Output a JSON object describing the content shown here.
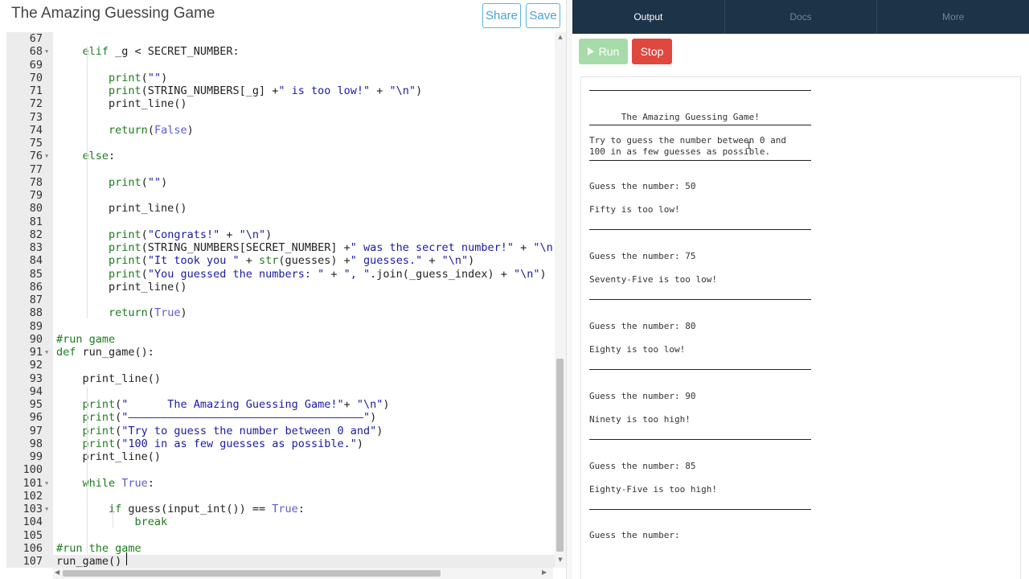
{
  "app": {
    "title": "The Amazing Guessing Game"
  },
  "toolbar": {
    "share_label": "Share",
    "save_label": "Save"
  },
  "tabs": [
    {
      "label": "Output",
      "active": true
    },
    {
      "label": "Docs",
      "active": false
    },
    {
      "label": "More",
      "active": false
    }
  ],
  "controls": {
    "run_label": "Run",
    "stop_label": "Stop"
  },
  "colors": {
    "run": "#a7dcaa",
    "stop": "#e0473f",
    "tabbar": "#1d3347",
    "accent": "#4aa3d3"
  },
  "editor": {
    "active_line": "107",
    "lines": [
      {
        "n": "67",
        "fold": false,
        "t": []
      },
      {
        "n": "68",
        "fold": true,
        "t": [
          [
            "    ",
            ""
          ],
          [
            "elif",
            "kw"
          ],
          [
            " _g < SECRET_NUMBER:",
            ""
          ]
        ]
      },
      {
        "n": "69",
        "fold": false,
        "t": []
      },
      {
        "n": "70",
        "fold": false,
        "t": [
          [
            "        ",
            ""
          ],
          [
            "print",
            "kw"
          ],
          [
            "(",
            ""
          ],
          [
            "\"\"",
            "str"
          ],
          [
            ")",
            ""
          ]
        ]
      },
      {
        "n": "71",
        "fold": false,
        "t": [
          [
            "        ",
            ""
          ],
          [
            "print",
            "kw"
          ],
          [
            "(STRING_NUMBERS[_g] +",
            ""
          ],
          [
            "\" is too low!\"",
            "str"
          ],
          [
            " + ",
            ""
          ],
          [
            "\"\\n\"",
            "str"
          ],
          [
            ")",
            ""
          ]
        ]
      },
      {
        "n": "72",
        "fold": false,
        "t": [
          [
            "        print_line()",
            ""
          ]
        ]
      },
      {
        "n": "73",
        "fold": false,
        "t": []
      },
      {
        "n": "74",
        "fold": false,
        "t": [
          [
            "        ",
            ""
          ],
          [
            "return",
            "kw"
          ],
          [
            "(",
            ""
          ],
          [
            "False",
            "con"
          ],
          [
            ")",
            ""
          ]
        ]
      },
      {
        "n": "75",
        "fold": false,
        "t": []
      },
      {
        "n": "76",
        "fold": true,
        "t": [
          [
            "    ",
            ""
          ],
          [
            "else",
            "kw"
          ],
          [
            ":",
            ""
          ]
        ]
      },
      {
        "n": "77",
        "fold": false,
        "t": []
      },
      {
        "n": "78",
        "fold": false,
        "t": [
          [
            "        ",
            ""
          ],
          [
            "print",
            "kw"
          ],
          [
            "(",
            ""
          ],
          [
            "\"\"",
            "str"
          ],
          [
            ")",
            ""
          ]
        ]
      },
      {
        "n": "79",
        "fold": false,
        "t": []
      },
      {
        "n": "80",
        "fold": false,
        "t": [
          [
            "        print_line()",
            ""
          ]
        ]
      },
      {
        "n": "81",
        "fold": false,
        "t": []
      },
      {
        "n": "82",
        "fold": false,
        "t": [
          [
            "        ",
            ""
          ],
          [
            "print",
            "kw"
          ],
          [
            "(",
            ""
          ],
          [
            "\"Congrats!\"",
            "str"
          ],
          [
            " + ",
            ""
          ],
          [
            "\"\\n\"",
            "str"
          ],
          [
            ")",
            ""
          ]
        ]
      },
      {
        "n": "83",
        "fold": false,
        "t": [
          [
            "        ",
            ""
          ],
          [
            "print",
            "kw"
          ],
          [
            "(STRING_NUMBERS[SECRET_NUMBER] +",
            ""
          ],
          [
            "\" was the secret number!\"",
            "str"
          ],
          [
            " + ",
            ""
          ],
          [
            "\"\\n\"",
            "str"
          ],
          [
            ")",
            ""
          ]
        ]
      },
      {
        "n": "84",
        "fold": false,
        "t": [
          [
            "        ",
            ""
          ],
          [
            "print",
            "kw"
          ],
          [
            "(",
            ""
          ],
          [
            "\"It took you \"",
            "str"
          ],
          [
            " + ",
            ""
          ],
          [
            "str",
            "kw"
          ],
          [
            "(guesses) +",
            ""
          ],
          [
            "\" guesses.\"",
            "str"
          ],
          [
            " + ",
            ""
          ],
          [
            "\"\\n\"",
            "str"
          ],
          [
            ")",
            ""
          ]
        ]
      },
      {
        "n": "85",
        "fold": false,
        "t": [
          [
            "        ",
            ""
          ],
          [
            "print",
            "kw"
          ],
          [
            "(",
            ""
          ],
          [
            "\"You guessed the numbers: \"",
            "str"
          ],
          [
            " + ",
            ""
          ],
          [
            "\", \"",
            "str"
          ],
          [
            ".join(_guess_index) + ",
            ""
          ],
          [
            "\"\\n\"",
            "str"
          ],
          [
            ")",
            ""
          ]
        ]
      },
      {
        "n": "86",
        "fold": false,
        "t": [
          [
            "        print_line()",
            ""
          ]
        ]
      },
      {
        "n": "87",
        "fold": false,
        "t": []
      },
      {
        "n": "88",
        "fold": false,
        "t": [
          [
            "        ",
            ""
          ],
          [
            "return",
            "kw"
          ],
          [
            "(",
            ""
          ],
          [
            "True",
            "con"
          ],
          [
            ")",
            ""
          ]
        ]
      },
      {
        "n": "89",
        "fold": false,
        "t": []
      },
      {
        "n": "90",
        "fold": false,
        "t": [
          [
            "#run game",
            "com"
          ]
        ]
      },
      {
        "n": "91",
        "fold": true,
        "t": [
          [
            "def",
            "kw"
          ],
          [
            " run_game():",
            ""
          ]
        ]
      },
      {
        "n": "92",
        "fold": false,
        "t": []
      },
      {
        "n": "93",
        "fold": false,
        "t": [
          [
            "    print_line()",
            ""
          ]
        ]
      },
      {
        "n": "94",
        "fold": false,
        "t": []
      },
      {
        "n": "95",
        "fold": false,
        "t": [
          [
            "    ",
            ""
          ],
          [
            "print",
            "kw"
          ],
          [
            "(",
            ""
          ],
          [
            "\"      The Amazing Guessing Game!\"",
            "str"
          ],
          [
            "+ ",
            ""
          ],
          [
            "\"\\n\"",
            "str"
          ],
          [
            ")",
            ""
          ]
        ]
      },
      {
        "n": "96",
        "fold": false,
        "t": [
          [
            "    ",
            ""
          ],
          [
            "print",
            "kw"
          ],
          [
            "(",
            ""
          ],
          [
            "\"————————————————————————————————————\"",
            "str"
          ],
          [
            ")",
            ""
          ]
        ]
      },
      {
        "n": "97",
        "fold": false,
        "t": [
          [
            "    ",
            ""
          ],
          [
            "print",
            "kw"
          ],
          [
            "(",
            ""
          ],
          [
            "\"Try to guess the number between 0 and\"",
            "str"
          ],
          [
            ")",
            ""
          ]
        ]
      },
      {
        "n": "98",
        "fold": false,
        "t": [
          [
            "    ",
            ""
          ],
          [
            "print",
            "kw"
          ],
          [
            "(",
            ""
          ],
          [
            "\"100 in as few guesses as possible.\"",
            "str"
          ],
          [
            ")",
            ""
          ]
        ]
      },
      {
        "n": "99",
        "fold": false,
        "t": [
          [
            "    print_line()",
            ""
          ]
        ]
      },
      {
        "n": "100",
        "fold": false,
        "t": []
      },
      {
        "n": "101",
        "fold": true,
        "t": [
          [
            "    ",
            ""
          ],
          [
            "while",
            "kw"
          ],
          [
            " ",
            ""
          ],
          [
            "True",
            "con"
          ],
          [
            ":",
            ""
          ]
        ]
      },
      {
        "n": "102",
        "fold": false,
        "t": []
      },
      {
        "n": "103",
        "fold": true,
        "t": [
          [
            "        ",
            ""
          ],
          [
            "if",
            "kw"
          ],
          [
            " guess(input_int()) == ",
            ""
          ],
          [
            "True",
            "con"
          ],
          [
            ":",
            ""
          ]
        ]
      },
      {
        "n": "104",
        "fold": false,
        "t": [
          [
            "            ",
            ""
          ],
          [
            "break",
            "kw"
          ]
        ]
      },
      {
        "n": "105",
        "fold": false,
        "t": []
      },
      {
        "n": "106",
        "fold": false,
        "t": [
          [
            "#run the game",
            "com"
          ]
        ]
      },
      {
        "n": "107",
        "fold": false,
        "t": [
          [
            "run_game()",
            ""
          ]
        ]
      }
    ]
  },
  "console": {
    "items": [
      {
        "kind": "rule"
      },
      {
        "kind": "blank"
      },
      {
        "kind": "text",
        "text": "      The Amazing Guessing Game!"
      },
      {
        "kind": "rule"
      },
      {
        "kind": "text",
        "text": "Try to guess the number between 0 and"
      },
      {
        "kind": "text",
        "text": "100 in as few guesses as possible."
      },
      {
        "kind": "rule"
      },
      {
        "kind": "blank"
      },
      {
        "kind": "text",
        "text": "Guess the number: 50"
      },
      {
        "kind": "blank"
      },
      {
        "kind": "text",
        "text": "Fifty is too low!"
      },
      {
        "kind": "blank"
      },
      {
        "kind": "rule"
      },
      {
        "kind": "blank"
      },
      {
        "kind": "text",
        "text": "Guess the number: 75"
      },
      {
        "kind": "blank"
      },
      {
        "kind": "text",
        "text": "Seventy-Five is too low!"
      },
      {
        "kind": "blank"
      },
      {
        "kind": "rule"
      },
      {
        "kind": "blank"
      },
      {
        "kind": "text",
        "text": "Guess the number: 80"
      },
      {
        "kind": "blank"
      },
      {
        "kind": "text",
        "text": "Eighty is too low!"
      },
      {
        "kind": "blank"
      },
      {
        "kind": "rule"
      },
      {
        "kind": "blank"
      },
      {
        "kind": "text",
        "text": "Guess the number: 90"
      },
      {
        "kind": "blank"
      },
      {
        "kind": "text",
        "text": "Ninety is too high!"
      },
      {
        "kind": "blank"
      },
      {
        "kind": "rule"
      },
      {
        "kind": "blank"
      },
      {
        "kind": "text",
        "text": "Guess the number: 85"
      },
      {
        "kind": "blank"
      },
      {
        "kind": "text",
        "text": "Eighty-Five is too high!"
      },
      {
        "kind": "blank"
      },
      {
        "kind": "rule"
      },
      {
        "kind": "blank"
      },
      {
        "kind": "text",
        "text": "Guess the number:"
      }
    ]
  }
}
